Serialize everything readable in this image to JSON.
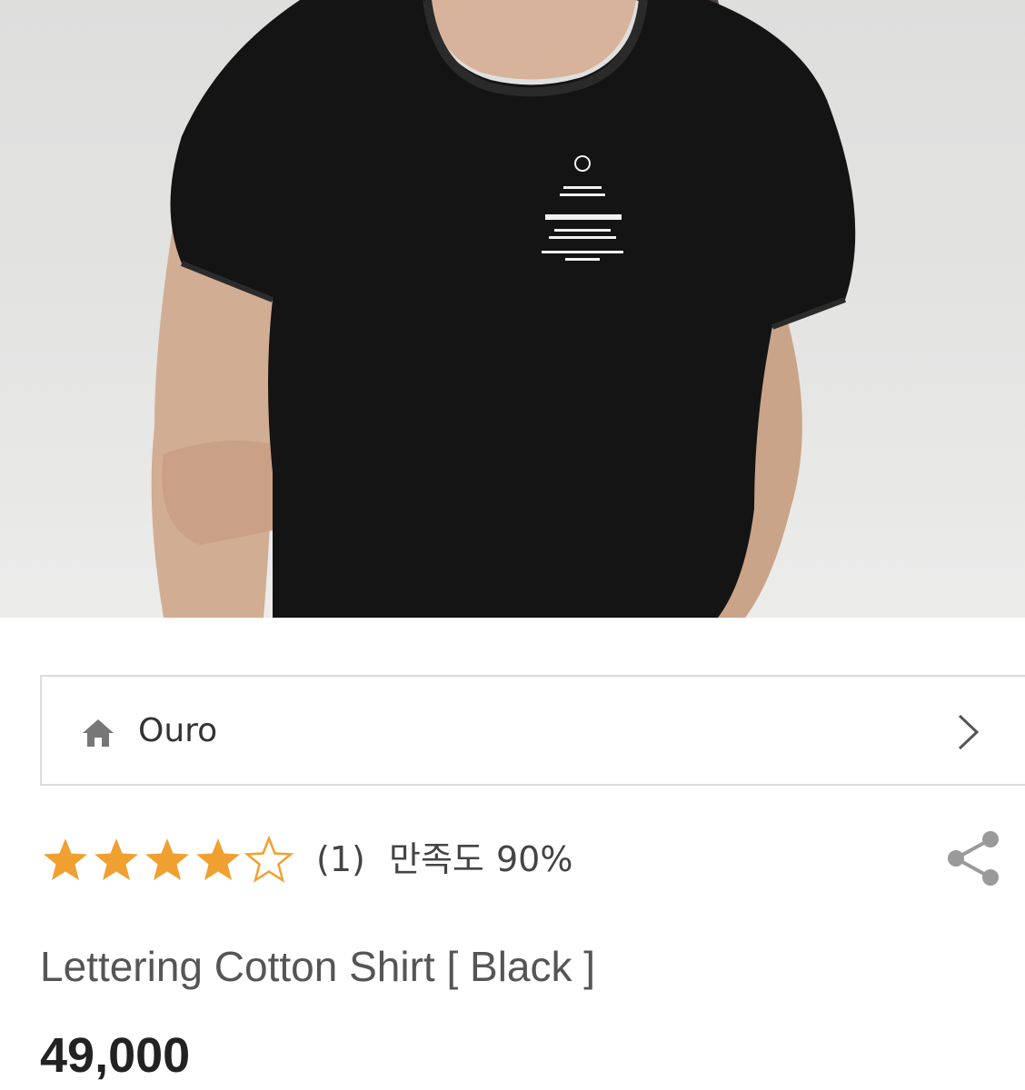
{
  "product_image": {
    "alt": ""
  },
  "store": {
    "name": "Ouro",
    "icon": "home-icon",
    "nav_icon": "chevron-right-icon"
  },
  "rating": {
    "score": 4,
    "max": 5,
    "review_count": "(1)",
    "satisfaction_label": "만족도",
    "satisfaction_value": "90%",
    "star_color": "#f0a030"
  },
  "share": {
    "icon": "share-icon"
  },
  "product": {
    "title": "Lettering Cotton Shirt [ Black ]",
    "price": "49,000"
  }
}
